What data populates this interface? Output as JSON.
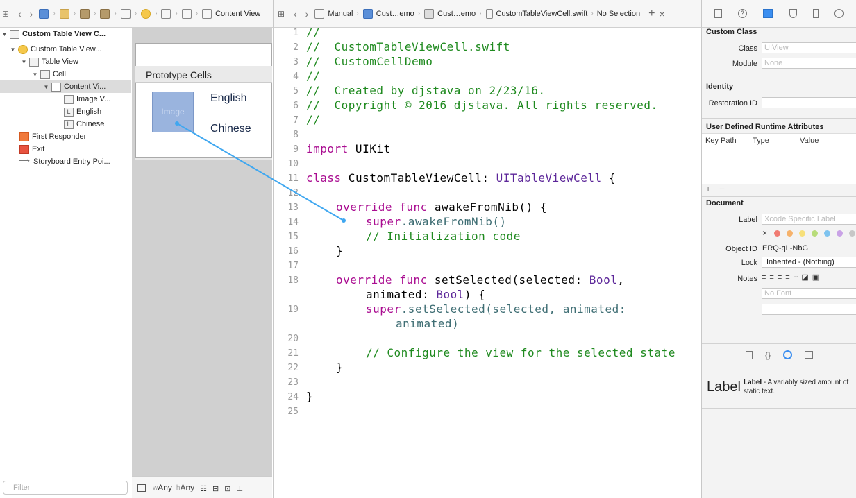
{
  "left_jumpbar": {
    "last_item": "Content View"
  },
  "editor_jumpbar": {
    "items": [
      "Manual",
      "Cust…emo",
      "Cust…emo",
      "CustomTableViewCell.swift",
      "No Selection"
    ],
    "add_symbol": "+",
    "close_symbol": "×"
  },
  "outline": {
    "items": [
      {
        "label": "Custom Table View C...",
        "icon": "scene-icon"
      },
      {
        "label": "Custom Table View...",
        "icon": "controller-icon"
      },
      {
        "label": "Table View",
        "icon": "table-view-icon"
      },
      {
        "label": "Cell",
        "icon": "cell-icon"
      },
      {
        "label": "Content Vi...",
        "icon": "view-icon"
      },
      {
        "label": "Image V...",
        "icon": "image-view-icon"
      },
      {
        "label": "English",
        "icon": "label-icon"
      },
      {
        "label": "Chinese",
        "icon": "label-icon"
      },
      {
        "label": "First Responder",
        "icon": "first-responder-icon"
      },
      {
        "label": "Exit",
        "icon": "exit-icon"
      },
      {
        "label": "Storyboard Entry Poi...",
        "icon": "entry-arrow-icon"
      }
    ],
    "label_glyph": "L",
    "filter_placeholder": "Filter"
  },
  "canvas": {
    "section_title": "Prototype Cells",
    "image_placeholder": "Image",
    "label_english": "English",
    "label_chinese": "Chinese",
    "size_class_w_prefix": "w",
    "size_class_w": "Any",
    "size_class_h_prefix": "h",
    "size_class_h": "Any"
  },
  "editor": {
    "line_numbers": [
      "1",
      "2",
      "3",
      "4",
      "5",
      "6",
      "7",
      "8",
      "9",
      "10",
      "11",
      "12",
      "13",
      "14",
      "15",
      "16",
      "17",
      "18",
      "19",
      "20",
      "21",
      "22",
      "23",
      "24",
      "25"
    ],
    "code": {
      "l1": "//",
      "l2": "//  CustomTableViewCell.swift",
      "l3": "//  CustomCellDemo",
      "l4": "//",
      "l5": "//  Created by djstava on 2/23/16.",
      "l6": "//  Copyright © 2016 djstava. All rights reserved.",
      "l7": "//",
      "l9_kw": "import",
      "l9_rest": " UIKit",
      "l11_kw": "class",
      "l11_name": " CustomTableViewCell: ",
      "l11_type": "UITableViewCell",
      "l11_end": " {",
      "l13_kw": "override func",
      "l13_rest": " awakeFromNib() {",
      "l14_kw": "super",
      "l14_rest": ".awakeFromNib()",
      "l15": "// Initialization code",
      "l16": "}",
      "l18_kw": "override func",
      "l18_rest": " setSelected(selected: ",
      "l18_type": "Bool",
      "l18_end": ",",
      "l18b_rest": "animated: ",
      "l18b_type": "Bool",
      "l18b_end": ") {",
      "l19_kw": "super",
      "l19_rest": ".setSelected(selected, animated:",
      "l19b": "animated)",
      "l21": "// Configure the view for the selected state",
      "l22": "}",
      "l24": "}"
    }
  },
  "inspector": {
    "custom_class_title": "Custom Class",
    "class_label": "Class",
    "class_placeholder": "UIView",
    "module_label": "Module",
    "module_placeholder": "None",
    "identity_title": "Identity",
    "restoration_label": "Restoration ID",
    "udra_title": "User Defined Runtime Attributes",
    "col_key_path": "Key Path",
    "col_type": "Type",
    "col_value": "Value",
    "plus": "+",
    "minus": "−",
    "document_title": "Document",
    "doc_label": "Label",
    "doc_label_placeholder": "Xcode Specific Label",
    "clear_symbol": "×",
    "object_id_label": "Object ID",
    "object_id": "ERQ-qL-NbG",
    "lock_label": "Lock",
    "lock_value": "Inherited - (Nothing)",
    "notes_label": "Notes",
    "font_placeholder": "No Font",
    "library_item_title": "Label",
    "library_item_name": "Label",
    "library_item_desc": " - A variably sized amount of static text.",
    "swatch_colors": [
      "#f07b72",
      "#f6b26b",
      "#f7e07a",
      "#b8dc7a",
      "#7ec3ef",
      "#c9a2e6",
      "#c7c7c7"
    ]
  }
}
